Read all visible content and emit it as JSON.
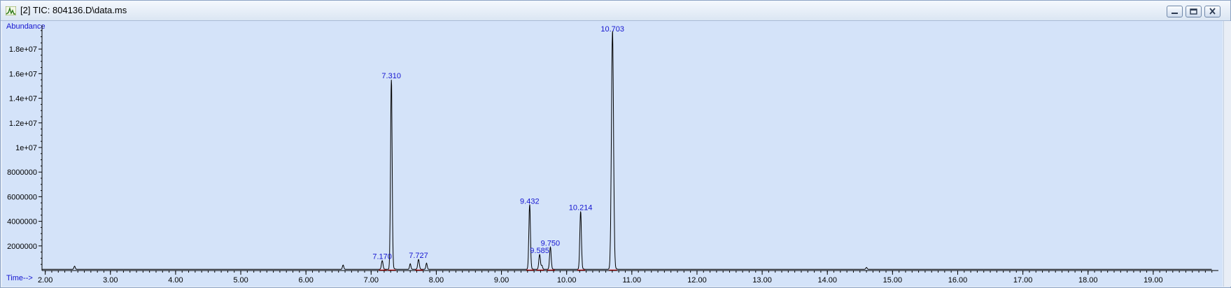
{
  "window": {
    "title": "[2] TIC: 804136.D\\data.ms",
    "icon": "chromatogram-app-icon",
    "controls": [
      "minimize-icon",
      "restore-icon",
      "close-icon"
    ]
  },
  "colors": {
    "background": "#d4e3f9",
    "trace": "#000000",
    "baseline": "#d00000",
    "labels": "#1515d0"
  },
  "chart_data": {
    "type": "line",
    "xlabel": "Time-->",
    "ylabel": "Abundance",
    "xlim": [
      1.95,
      20.0
    ],
    "ylim": [
      0,
      19600000
    ],
    "x_ticks": [
      "2.00",
      "3.00",
      "4.00",
      "5.00",
      "6.00",
      "7.00",
      "8.00",
      "9.00",
      "10.00",
      "11.00",
      "12.00",
      "13.00",
      "14.00",
      "15.00",
      "16.00",
      "17.00",
      "18.00",
      "19.00"
    ],
    "x_tick_values": [
      2,
      3,
      4,
      5,
      6,
      7,
      8,
      9,
      10,
      11,
      12,
      13,
      14,
      15,
      16,
      17,
      18,
      19
    ],
    "y_ticks": [
      "2000000",
      "4000000",
      "6000000",
      "8000000",
      "1e+07",
      "1.2e+07",
      "1.4e+07",
      "1.6e+07",
      "1.8e+07"
    ],
    "y_tick_values": [
      2000000,
      4000000,
      6000000,
      8000000,
      10000000,
      12000000,
      14000000,
      16000000,
      18000000
    ],
    "grid": false,
    "baseline_abundance": 100000,
    "peaks": [
      {
        "label": "7.170",
        "rt": 7.17,
        "height": 700000,
        "width": 0.012
      },
      {
        "label": "7.310",
        "rt": 7.31,
        "height": 15400000,
        "width": 0.012
      },
      {
        "label": "7.727",
        "rt": 7.727,
        "height": 800000,
        "width": 0.012
      },
      {
        "label": "9.432",
        "rt": 9.432,
        "height": 5200000,
        "width": 0.012
      },
      {
        "label": "9.585",
        "rt": 9.585,
        "height": 1200000,
        "width": 0.012
      },
      {
        "label": "9.750",
        "rt": 9.75,
        "height": 1800000,
        "width": 0.012
      },
      {
        "label": "10.214",
        "rt": 10.214,
        "height": 4700000,
        "width": 0.012
      },
      {
        "label": "10.703",
        "rt": 10.703,
        "height": 19200000,
        "width": 0.016
      }
    ],
    "minor_peaks": [
      {
        "rt": 2.45,
        "height": 250000
      },
      {
        "rt": 6.57,
        "height": 350000
      },
      {
        "rt": 7.6,
        "height": 450000
      },
      {
        "rt": 7.85,
        "height": 500000
      },
      {
        "rt": 9.62,
        "height": 300000
      },
      {
        "rt": 14.6,
        "height": 150000
      }
    ]
  }
}
